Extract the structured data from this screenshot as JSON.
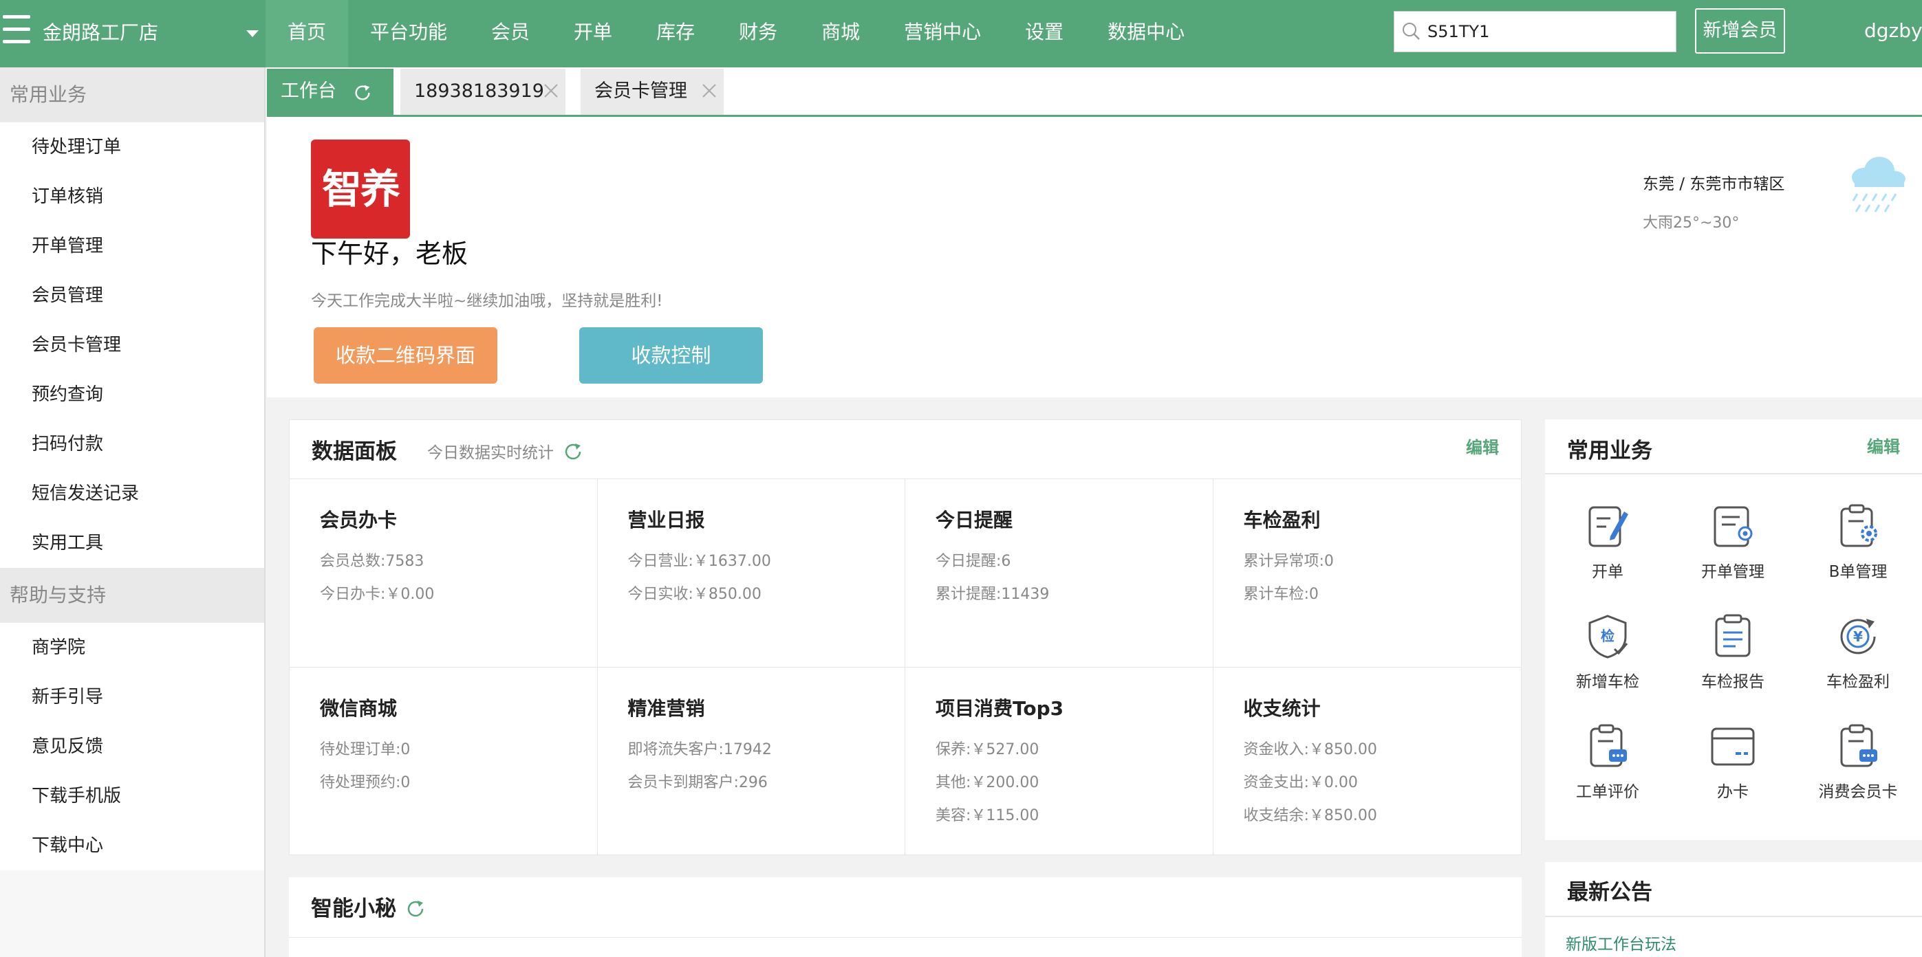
{
  "topbar": {
    "store_name": "金朗路工厂店",
    "nav": [
      "首页",
      "平台功能",
      "会员",
      "开单",
      "库存",
      "财务",
      "商城",
      "营销中心",
      "设置",
      "数据中心"
    ],
    "search_value": "S51TY1",
    "new_member_label": "新增会员",
    "user": "dgzbyc"
  },
  "sidebar": {
    "group1": "常用业务",
    "items1": [
      "待处理订单",
      "订单核销",
      "开单管理",
      "会员管理",
      "会员卡管理",
      "预约查询",
      "扫码付款",
      "短信发送记录",
      "实用工具"
    ],
    "group2": "帮助与支持",
    "items2": [
      "商学院",
      "新手引导",
      "意见反馈",
      "下载手机版",
      "下载中心"
    ]
  },
  "tabs": [
    "工作台",
    "18938183919",
    "会员卡管理"
  ],
  "welcome": {
    "logo_text": "智养",
    "greeting": "下午好，老板",
    "motto": "今天工作完成大半啦~继续加油哦，坚持就是胜利!",
    "btn_qr": "收款二维码界面",
    "btn_control": "收款控制",
    "location": "东莞 / 东莞市市辖区",
    "weather": "大雨25°~30°"
  },
  "panel": {
    "title": "数据面板",
    "subtitle": "今日数据实时统计",
    "edit": "编辑",
    "cells": [
      {
        "title": "会员办卡",
        "lines": [
          "会员总数:7583",
          "今日办卡:￥0.00"
        ]
      },
      {
        "title": "营业日报",
        "lines": [
          "今日营业:￥1637.00",
          "今日实收:￥850.00"
        ]
      },
      {
        "title": "今日提醒",
        "lines": [
          "今日提醒:6",
          "累计提醒:11439"
        ]
      },
      {
        "title": "车检盈利",
        "lines": [
          "累计异常项:0",
          "累计车检:0"
        ]
      },
      {
        "title": "微信商城",
        "lines": [
          "待处理订单:0",
          "待处理预约:0"
        ]
      },
      {
        "title": "精准营销",
        "lines": [
          "即将流失客户:17942",
          "会员卡到期客户:296"
        ]
      },
      {
        "title": "项目消费Top3",
        "lines": [
          "保养:￥527.00",
          "其他:￥200.00",
          "美容:￥115.00"
        ]
      },
      {
        "title": "收支统计",
        "lines": [
          "资金收入:￥850.00",
          "资金支出:￥0.00",
          "收支结余:￥850.00"
        ]
      }
    ]
  },
  "biz": {
    "title": "常用业务",
    "edit": "编辑",
    "items": [
      {
        "label": "开单",
        "icon": "edit-doc-icon"
      },
      {
        "label": "开单管理",
        "icon": "doc-eye-icon"
      },
      {
        "label": "B单管理",
        "icon": "clipboard-gear-icon"
      },
      {
        "label": "新增车检",
        "icon": "shield-check-icon"
      },
      {
        "label": "车检报告",
        "icon": "report-icon"
      },
      {
        "label": "车检盈利",
        "icon": "yen-cycle-icon"
      },
      {
        "label": "工单评价",
        "icon": "clipboard-chat-icon"
      },
      {
        "label": "办卡",
        "icon": "card-icon"
      },
      {
        "label": "消费会员卡",
        "icon": "clipboard-card-icon"
      }
    ]
  },
  "assistant": {
    "title": "智能小秘"
  },
  "notice": {
    "title": "最新公告",
    "link": "新版工作台玩法"
  }
}
